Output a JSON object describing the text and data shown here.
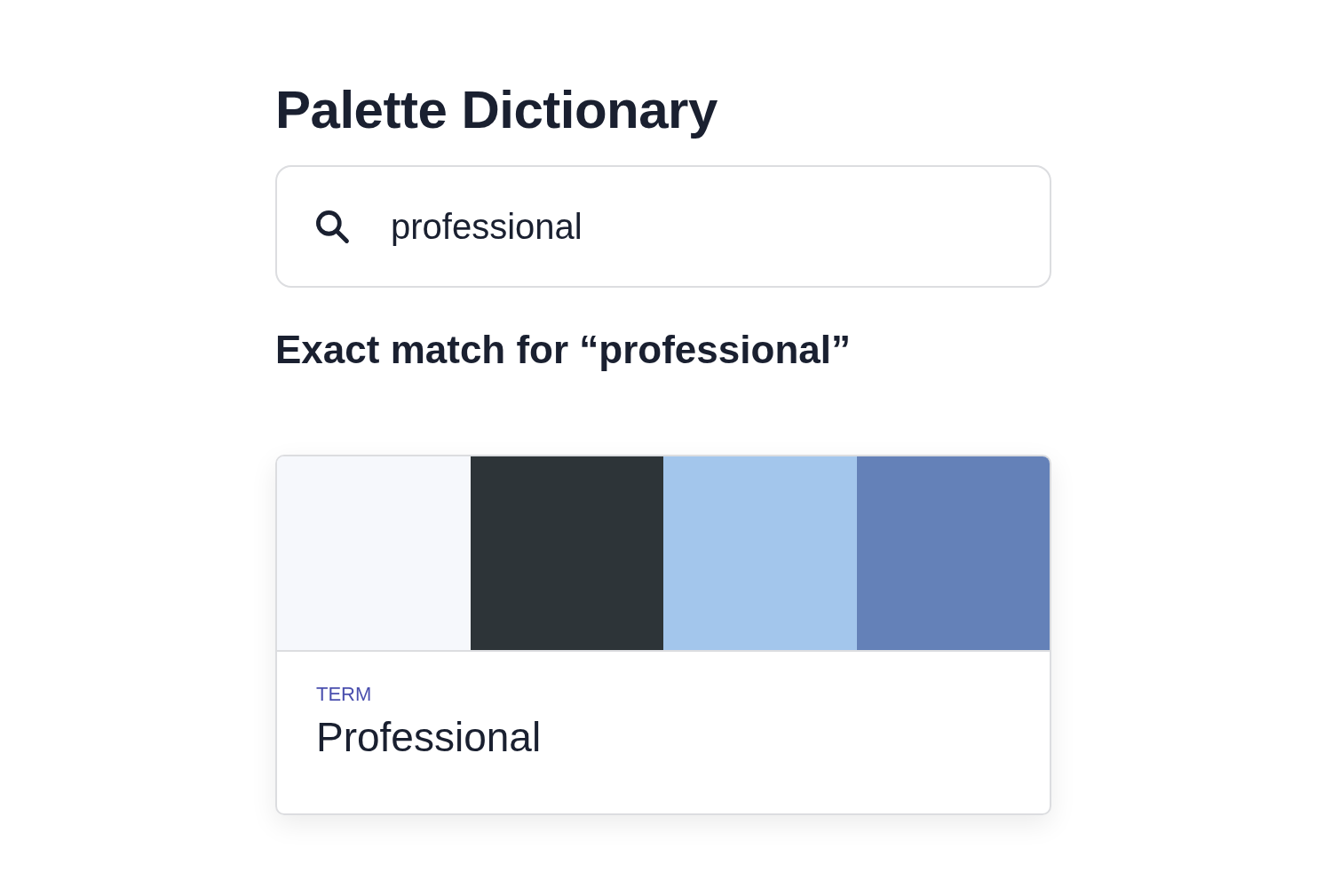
{
  "title": "Palette Dictionary",
  "search": {
    "value": "professional"
  },
  "result_heading": "Exact match for “professional”",
  "card": {
    "swatches": [
      {
        "color": "#f6f8fc"
      },
      {
        "color": "#2d3438"
      },
      {
        "color": "#a3c6ec"
      },
      {
        "color": "#6481b8"
      }
    ],
    "label": "TERM",
    "term": "Professional"
  }
}
